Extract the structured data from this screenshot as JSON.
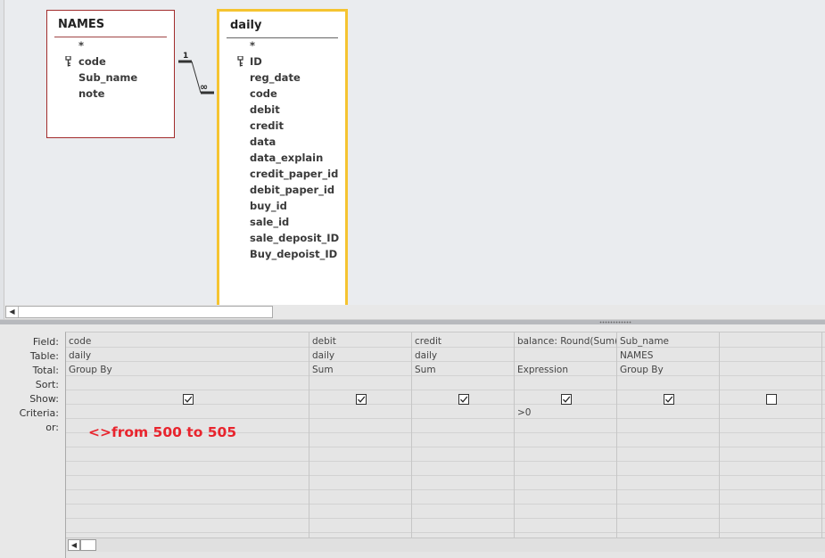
{
  "tables": {
    "names": {
      "title": "NAMES",
      "fields": [
        "*",
        "code",
        "Sub_name",
        "note"
      ],
      "key_field": "code"
    },
    "daily": {
      "title": "daily",
      "fields": [
        "*",
        "ID",
        "reg_date",
        "code",
        "debit",
        "credit",
        "data",
        "data_explain",
        "credit_paper_id",
        "debit_paper_id",
        "buy_id",
        "sale_id",
        "sale_deposit_ID",
        "Buy_depoist_ID"
      ],
      "key_field": "ID"
    }
  },
  "relationship": {
    "one_label": "1",
    "many_label": "∞"
  },
  "grid": {
    "row_headers": [
      "Field:",
      "Table:",
      "Total:",
      "Sort:",
      "Show:",
      "Criteria:",
      "or:"
    ],
    "columns": [
      {
        "field": "code",
        "table": "daily",
        "total": "Group By",
        "sort": "",
        "show": true,
        "criteria": "",
        "or": "<>from 500 to 505"
      },
      {
        "field": "debit",
        "table": "daily",
        "total": "Sum",
        "sort": "",
        "show": true,
        "criteria": "",
        "or": ""
      },
      {
        "field": "credit",
        "table": "daily",
        "total": "Sum",
        "sort": "",
        "show": true,
        "criteria": "",
        "or": ""
      },
      {
        "field": "balance: Round(Sum([c",
        "table": "",
        "total": "Expression",
        "sort": "",
        "show": true,
        "criteria": ">0",
        "or": ""
      },
      {
        "field": "Sub_name",
        "table": "NAMES",
        "total": "Group By",
        "sort": "",
        "show": true,
        "criteria": "",
        "or": ""
      },
      {
        "field": "",
        "table": "",
        "total": "",
        "sort": "",
        "show": false,
        "criteria": "",
        "or": ""
      }
    ]
  },
  "colors": {
    "names_border": "#a22c2c",
    "daily_border_selected": "#f5c431",
    "or_note": "#e8242d"
  },
  "icons": {
    "key": "key-icon",
    "checkbox": "checkbox-icon",
    "scroll_left": "scroll-left-arrow-icon"
  }
}
